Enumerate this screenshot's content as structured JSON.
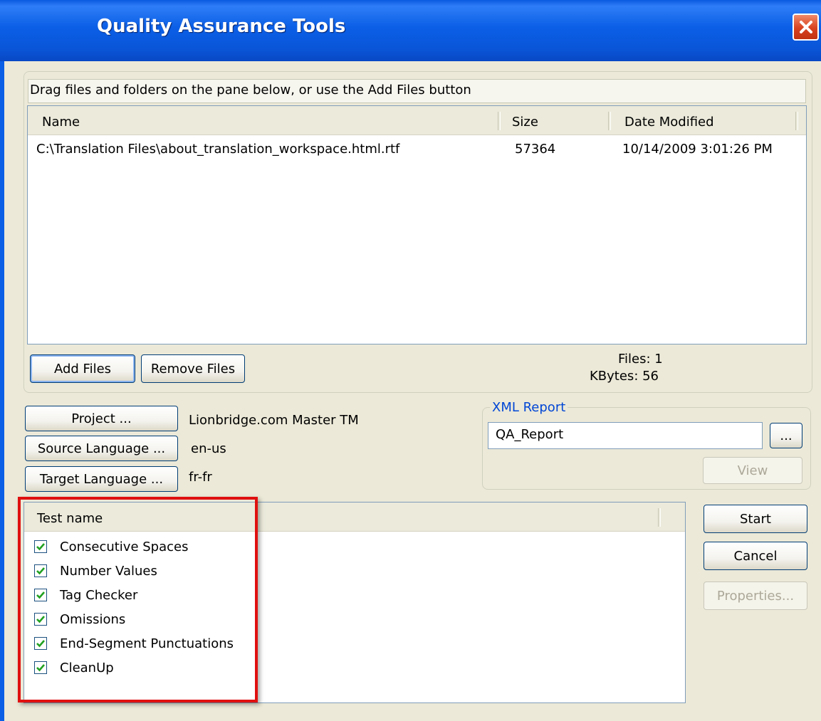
{
  "window": {
    "title": "Quality Assurance Tools",
    "close_icon": "close-icon"
  },
  "files": {
    "hint": "Drag files and folders on the pane below, or use the Add Files button",
    "columns": [
      "Name",
      "Size",
      "Date Modified"
    ],
    "rows": [
      {
        "name": "C:\\Translation Files\\about_translation_workspace.html.rtf",
        "size": "57364",
        "date": "10/14/2009 3:01:26 PM"
      }
    ],
    "add_label": "Add Files",
    "remove_label": "Remove Files",
    "files_stat": "Files: 1",
    "kbytes_stat": "KBytes: 56"
  },
  "settings": {
    "project_label": "Project ...",
    "project_value": "Lionbridge.com Master TM",
    "source_label": "Source Language ...",
    "source_value": "en-us",
    "target_label": "Target Language ...",
    "target_value": "fr-fr"
  },
  "xml_report": {
    "legend": "XML Report",
    "value": "QA_Report",
    "browse_label": "...",
    "view_label": "View"
  },
  "tests": {
    "header": "Test name",
    "items": [
      {
        "label": "Consecutive Spaces",
        "checked": true
      },
      {
        "label": "Number Values",
        "checked": true
      },
      {
        "label": "Tag Checker",
        "checked": true
      },
      {
        "label": "Omissions",
        "checked": true
      },
      {
        "label": "End-Segment Punctuations",
        "checked": true
      },
      {
        "label": "CleanUp",
        "checked": true
      }
    ]
  },
  "actions": {
    "start_label": "Start",
    "cancel_label": "Cancel",
    "properties_label": "Properties..."
  },
  "colors": {
    "titlebar": "#0a55d8",
    "highlight": "#e01010",
    "check": "#21a121"
  }
}
